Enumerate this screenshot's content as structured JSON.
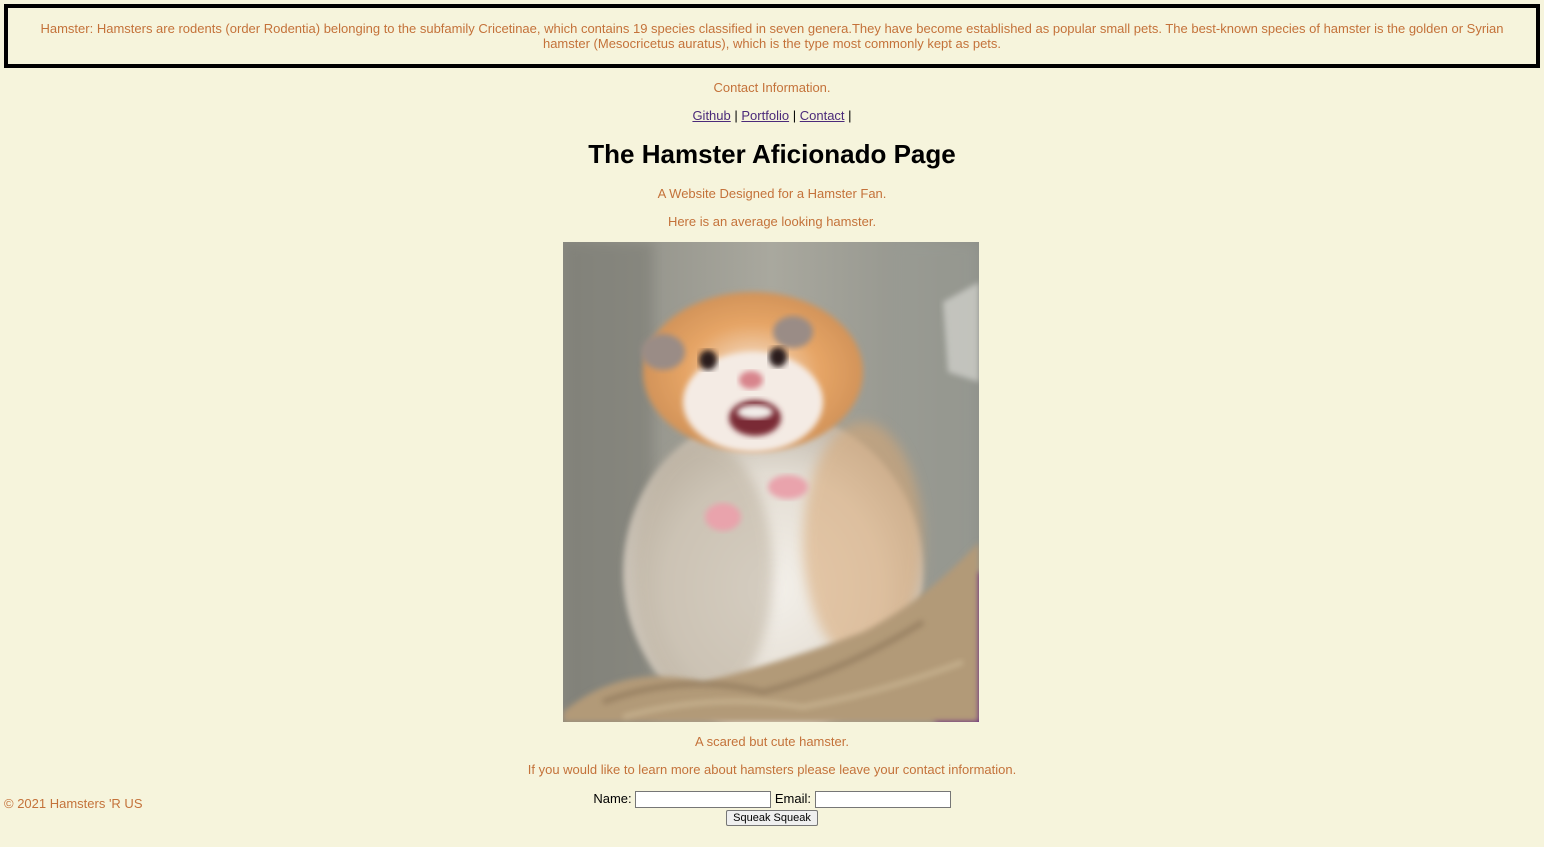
{
  "banner": {
    "text": "Hamster: Hamsters are rodents (order Rodentia) belonging to the subfamily Cricetinae, which contains 19 species classified in seven genera.They have become established as popular small pets. The best-known species of hamster is the golden or Syrian hamster (Mesocricetus auratus), which is the type most commonly kept as pets."
  },
  "contact_heading": "Contact Information.",
  "nav": {
    "github": "Github",
    "portfolio": "Portfolio",
    "contact": "Contact",
    "separator": "|"
  },
  "title": "The Hamster Aficionado Page",
  "subtitle": "A Website Designed for a Hamster Fan.",
  "intro": "Here is an average looking hamster.",
  "caption": "A scared but cute hamster.",
  "invite": "If you would like to learn more about hamsters please leave your contact information.",
  "form": {
    "name_label": "Name:",
    "email_label": "Email:",
    "name_value": "",
    "email_value": "",
    "submit_label": "Squeak Squeak"
  },
  "footer": "© 2021 Hamsters 'R US",
  "colors": {
    "background": "#f6f4dc",
    "text_accent": "#c4723a",
    "link": "#4b2a7a"
  }
}
